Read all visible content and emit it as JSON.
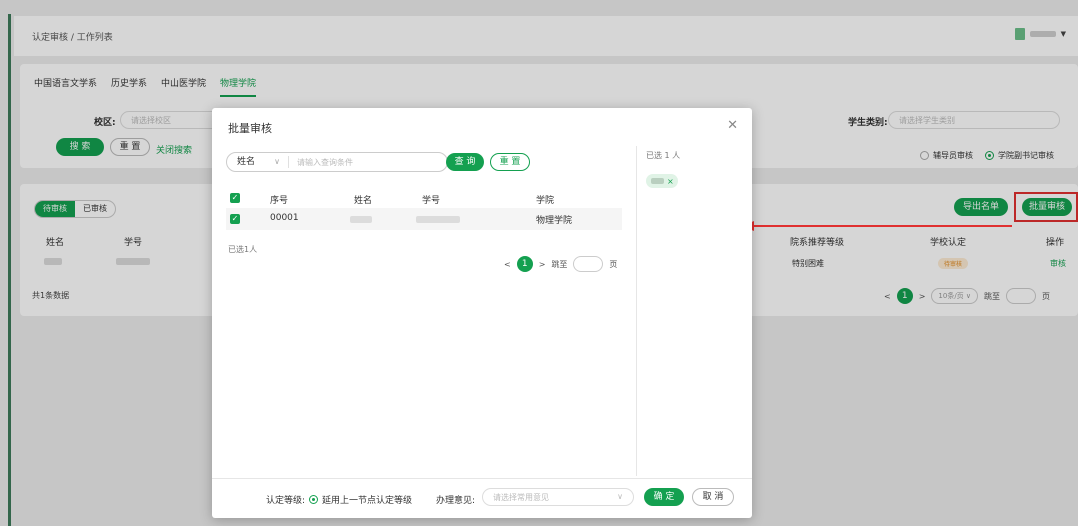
{
  "header": {
    "breadcrumb": "认定审核 / 工作列表"
  },
  "tabs": [
    {
      "label": "中国语言文学系",
      "active": false
    },
    {
      "label": "历史学系",
      "active": false
    },
    {
      "label": "中山医学院",
      "active": false
    },
    {
      "label": "物理学院",
      "active": true
    }
  ],
  "filters": {
    "campus_label": "校区:",
    "campus_placeholder": "请选择校区",
    "student_type_label": "学生类别:",
    "student_type_placeholder": "请选择学生类别",
    "search_button": "搜 索",
    "reset_button": "重 置",
    "close_search": "关闭搜索",
    "radio_counselor": "辅导员审核",
    "radio_vice_secretary": "学院副书记审核"
  },
  "list": {
    "tab_pending": "待审核",
    "tab_done": "已审核",
    "col_name": "姓名",
    "col_id": "学号",
    "col_recommend": "院系推荐等级",
    "col_school": "学校认定",
    "col_op": "操作",
    "export_button": "导出名单",
    "batch_button": "批量审核",
    "row": {
      "recommend": "特别困难",
      "status": "待审核",
      "op": "审核"
    },
    "total": "共1条数据",
    "pager": {
      "page": "1",
      "page_size": "10条/页",
      "goto": "跳至",
      "page_unit": "页"
    }
  },
  "dialog": {
    "title": "批量审核",
    "search_field": "姓名",
    "search_placeholder": "请输入查询条件",
    "query_button": "查 询",
    "reset_button": "重 置",
    "columns": [
      "序号",
      "姓名",
      "学号",
      "学院"
    ],
    "row": {
      "index": "00001",
      "college": "物理学院"
    },
    "selected_left": "已选1人",
    "selected_right": "已选 1 人",
    "pager": {
      "page": "1",
      "goto": "跳至",
      "page_unit": "页"
    },
    "footer": {
      "level_label": "认定等级:",
      "level_option": "延用上一节点认定等级",
      "opinion_label": "办理意见:",
      "opinion_placeholder": "请选择常用意见",
      "confirm": "确 定",
      "cancel": "取 消"
    }
  },
  "colors": {
    "accent": "#14a050",
    "highlight": "#e03030"
  }
}
